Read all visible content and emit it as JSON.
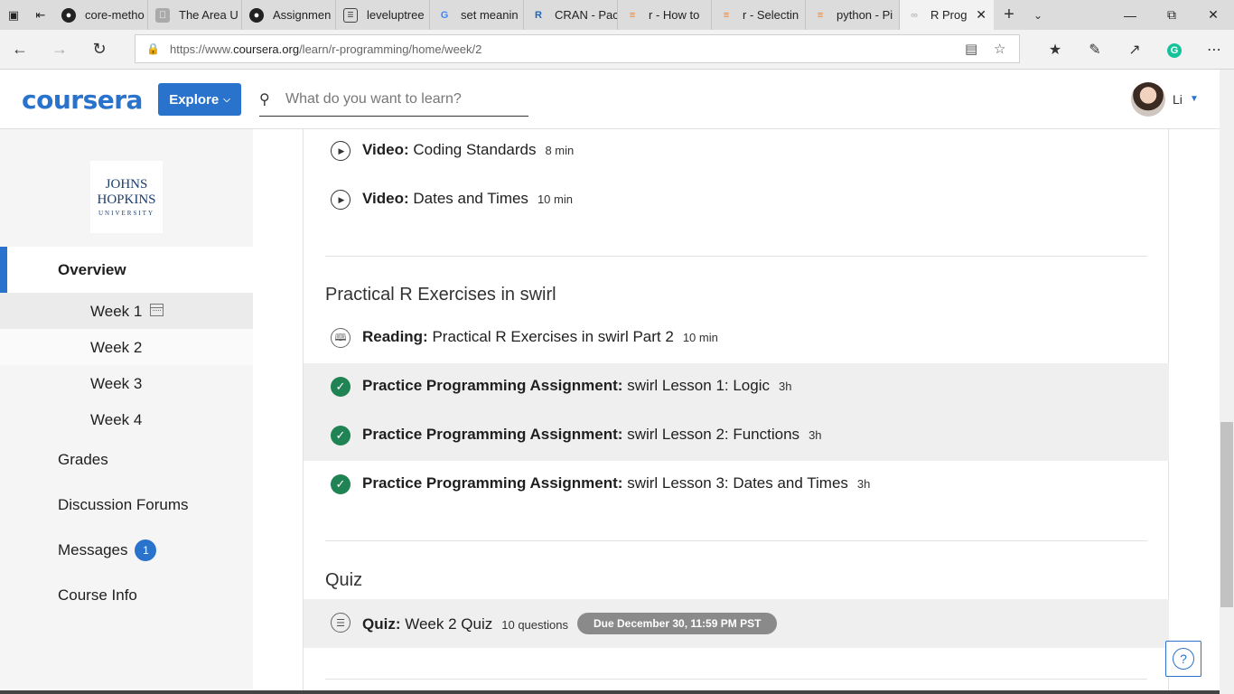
{
  "browser": {
    "tabs": [
      {
        "title": "core-metho",
        "favicon": "github-icon"
      },
      {
        "title": "The Area U",
        "favicon": "apple-icon"
      },
      {
        "title": "Assignmen",
        "favicon": "github-icon"
      },
      {
        "title": "leveluptree",
        "favicon": "page-icon"
      },
      {
        "title": "set meanin",
        "favicon": "google-icon"
      },
      {
        "title": "CRAN - Pac",
        "favicon": "r-icon"
      },
      {
        "title": "r - How to",
        "favicon": "stackoverflow-icon"
      },
      {
        "title": "r - Selectin",
        "favicon": "stackoverflow-icon"
      },
      {
        "title": "python - Pi",
        "favicon": "stackoverflow-icon"
      },
      {
        "title": "R Prog",
        "favicon": "coursera-icon",
        "active": true
      }
    ],
    "url_prefix": "https://www.",
    "url_domain": "coursera.org",
    "url_path": "/learn/r-programming/home/week/2"
  },
  "header": {
    "logo": "coursera",
    "explore_label": "Explore",
    "search_placeholder": "What do you want to learn?",
    "user_name": "Li"
  },
  "sidebar": {
    "university": {
      "line1": "JOHNS",
      "line2": "HOPKINS",
      "line3": "UNIVERSITY"
    },
    "overview_label": "Overview",
    "weeks": [
      "Week 1",
      "Week 2",
      "Week 3",
      "Week 4"
    ],
    "grades_label": "Grades",
    "forums_label": "Discussion Forums",
    "messages_label": "Messages",
    "messages_count": "1",
    "course_info_label": "Course Info"
  },
  "main": {
    "videos": [
      {
        "type": "Video:",
        "title": "Coding Standards",
        "duration": "8 min"
      },
      {
        "type": "Video:",
        "title": "Dates and Times",
        "duration": "10 min"
      }
    ],
    "swirl_section": {
      "title": "Practical R Exercises in swirl",
      "reading": {
        "type": "Reading:",
        "title": "Practical R Exercises in swirl Part 2",
        "duration": "10 min"
      },
      "assignments": [
        {
          "type": "Practice Programming Assignment:",
          "title": "swirl Lesson 1: Logic",
          "duration": "3h"
        },
        {
          "type": "Practice Programming Assignment:",
          "title": "swirl Lesson 2: Functions",
          "duration": "3h"
        },
        {
          "type": "Practice Programming Assignment:",
          "title": "swirl Lesson 3: Dates and Times",
          "duration": "3h"
        }
      ]
    },
    "quiz_section": {
      "title": "Quiz",
      "quiz": {
        "type": "Quiz:",
        "title": "Week 2 Quiz",
        "questions": "10 questions",
        "due": "Due December 30, 11:59 PM PST"
      }
    }
  },
  "colors": {
    "accent": "#2a73cc",
    "complete": "#1f8354",
    "due_pill": "#8a8a8a"
  }
}
